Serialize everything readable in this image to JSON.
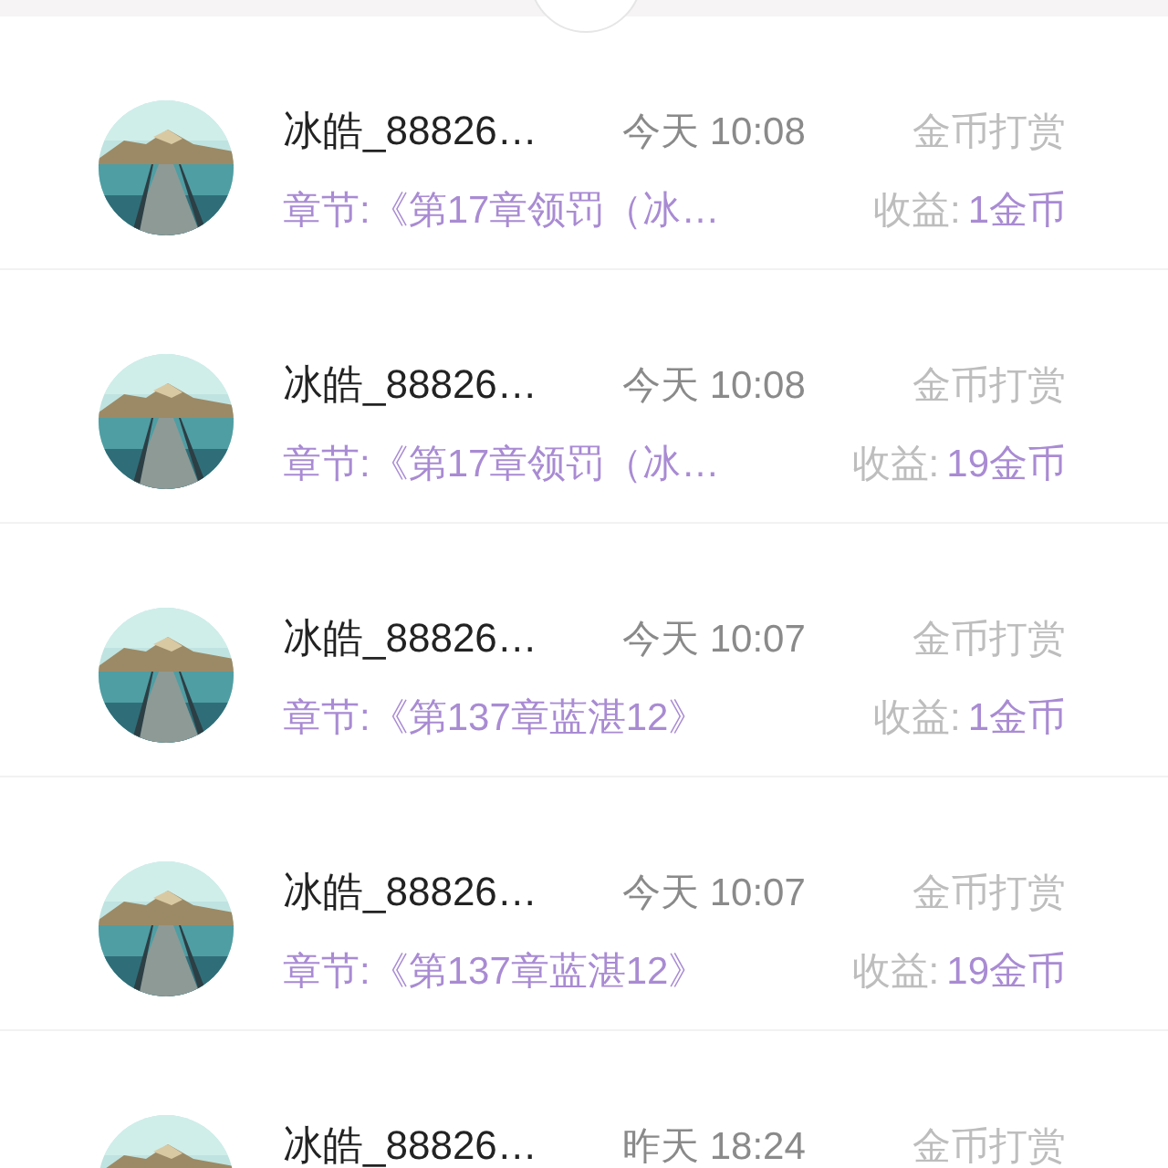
{
  "records": [
    {
      "user": "冰皓_88826…",
      "time": "今天 10:08",
      "type": "金币打赏",
      "chapter": "章节:《第17章领罚（冰…",
      "income_label": "收益:",
      "income_value": "1金币"
    },
    {
      "user": "冰皓_88826…",
      "time": "今天 10:08",
      "type": "金币打赏",
      "chapter": "章节:《第17章领罚（冰…",
      "income_label": "收益:",
      "income_value": "19金币"
    },
    {
      "user": "冰皓_88826…",
      "time": "今天 10:07",
      "type": "金币打赏",
      "chapter": "章节:《第137章蓝湛12》",
      "income_label": "收益:",
      "income_value": "1金币"
    },
    {
      "user": "冰皓_88826…",
      "time": "今天 10:07",
      "type": "金币打赏",
      "chapter": "章节:《第137章蓝湛12》",
      "income_label": "收益:",
      "income_value": "19金币"
    },
    {
      "user": "冰皓_88826…",
      "time": "昨天 18:24",
      "type": "金币打赏"
    }
  ]
}
